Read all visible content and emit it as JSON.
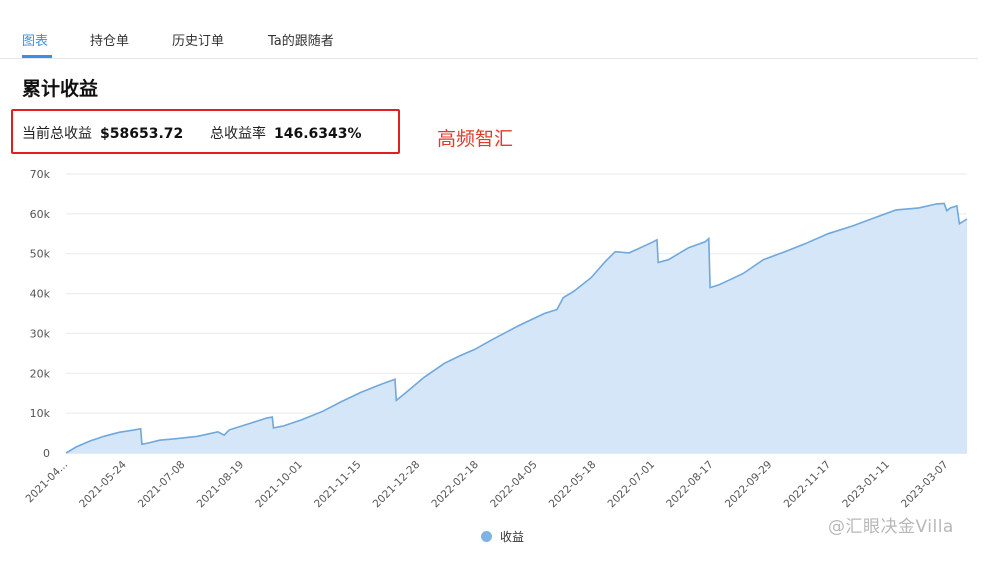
{
  "tabs": [
    {
      "label": "图表",
      "active": true
    },
    {
      "label": "持仓单",
      "active": false
    },
    {
      "label": "历史订单",
      "active": false
    },
    {
      "label": "Ta的跟随者",
      "active": false
    }
  ],
  "section_title": "累计收益",
  "summary": {
    "total_profit_label": "当前总收益",
    "total_profit_value": "$58653.72",
    "return_rate_label": "总收益率",
    "return_rate_value": "146.6343%"
  },
  "annotation": "高频智汇",
  "watermark": "@汇眼决金Villa",
  "colors": {
    "accent": "#3d8ee0",
    "line": "#6fa8dc",
    "area": "#d4e6f8",
    "highlight_box": "#e02020"
  },
  "chart_data": {
    "type": "area",
    "series": [
      {
        "name": "收益"
      }
    ],
    "ylim": [
      0,
      70000
    ],
    "y_ticks": [
      0,
      10000,
      20000,
      30000,
      40000,
      50000,
      60000,
      70000
    ],
    "y_tick_labels": [
      "0",
      "10k",
      "20k",
      "30k",
      "40k",
      "50k",
      "60k",
      "70k"
    ],
    "x_range": [
      "2021-04-12",
      "2023-03-25"
    ],
    "x_tick_labels": [
      "2021-04...",
      "2021-05-24",
      "2021-07-08",
      "2021-08-19",
      "2021-10-01",
      "2021-11-15",
      "2021-12-28",
      "2022-02-18",
      "2022-04-05",
      "2022-05-18",
      "2022-07-01",
      "2022-08-17",
      "2022-09-29",
      "2022-11-17",
      "2023-01-11",
      "2023-03-07"
    ],
    "grid": true,
    "legend_position": "bottom-center",
    "points": [
      [
        "2021-04-12",
        0
      ],
      [
        "2021-04-20",
        1500
      ],
      [
        "2021-05-01",
        3000
      ],
      [
        "2021-05-12",
        4200
      ],
      [
        "2021-05-24",
        5200
      ],
      [
        "2021-06-05",
        5800
      ],
      [
        "2021-06-10",
        6100
      ],
      [
        "2021-06-11",
        2200
      ],
      [
        "2021-06-16",
        2500
      ],
      [
        "2021-06-25",
        3200
      ],
      [
        "2021-07-08",
        3600
      ],
      [
        "2021-07-25",
        4200
      ],
      [
        "2021-08-10",
        5300
      ],
      [
        "2021-08-15",
        4500
      ],
      [
        "2021-08-19",
        5800
      ],
      [
        "2021-09-05",
        7500
      ],
      [
        "2021-09-18",
        8800
      ],
      [
        "2021-09-22",
        9000
      ],
      [
        "2021-09-23",
        6300
      ],
      [
        "2021-10-01",
        6800
      ],
      [
        "2021-10-15",
        8300
      ],
      [
        "2021-11-01",
        10500
      ],
      [
        "2021-11-15",
        12800
      ],
      [
        "2021-12-01",
        15200
      ],
      [
        "2021-12-15",
        17000
      ],
      [
        "2021-12-28",
        18500
      ],
      [
        "2021-12-29",
        13200
      ],
      [
        "2022-01-05",
        15000
      ],
      [
        "2022-01-20",
        19000
      ],
      [
        "2022-02-05",
        22500
      ],
      [
        "2022-02-18",
        24500
      ],
      [
        "2022-03-01",
        26000
      ],
      [
        "2022-03-15",
        28500
      ],
      [
        "2022-04-05",
        32000
      ],
      [
        "2022-04-25",
        35000
      ],
      [
        "2022-05-05",
        36000
      ],
      [
        "2022-05-10",
        39000
      ],
      [
        "2022-05-18",
        40500
      ],
      [
        "2022-06-01",
        44000
      ],
      [
        "2022-06-12",
        48000
      ],
      [
        "2022-06-20",
        50500
      ],
      [
        "2022-07-01",
        50200
      ],
      [
        "2022-07-10",
        51500
      ],
      [
        "2022-07-20",
        53000
      ],
      [
        "2022-07-23",
        53500
      ],
      [
        "2022-07-24",
        47800
      ],
      [
        "2022-08-01",
        48500
      ],
      [
        "2022-08-17",
        51500
      ],
      [
        "2022-08-30",
        53000
      ],
      [
        "2022-09-02",
        53800
      ],
      [
        "2022-09-03",
        41500
      ],
      [
        "2022-09-10",
        42200
      ],
      [
        "2022-09-29",
        45000
      ],
      [
        "2022-10-15",
        48500
      ],
      [
        "2022-11-01",
        50500
      ],
      [
        "2022-11-17",
        52500
      ],
      [
        "2022-12-05",
        55000
      ],
      [
        "2022-12-25",
        57000
      ],
      [
        "2023-01-11",
        59000
      ],
      [
        "2023-01-28",
        61000
      ],
      [
        "2023-02-15",
        61500
      ],
      [
        "2023-03-01",
        62500
      ],
      [
        "2023-03-07",
        62600
      ],
      [
        "2023-03-09",
        60800
      ],
      [
        "2023-03-12",
        61500
      ],
      [
        "2023-03-17",
        62000
      ],
      [
        "2023-03-19",
        57500
      ],
      [
        "2023-03-25",
        58700
      ]
    ]
  }
}
